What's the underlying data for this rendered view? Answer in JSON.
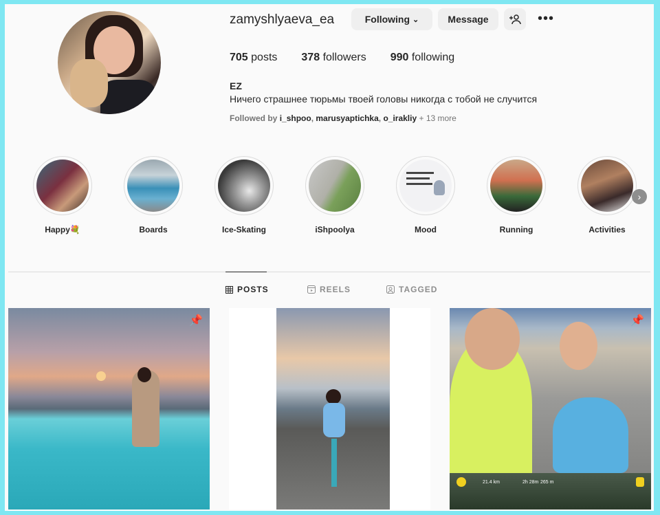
{
  "profile": {
    "username": "zamyshlyaeva_ea",
    "following_button": "Following",
    "message_button": "Message",
    "more_label": "•••",
    "posts_count": "705",
    "posts_label": "posts",
    "followers_count": "378",
    "followers_label": "followers",
    "following_count": "990",
    "following_label": "following",
    "name": "EZ",
    "bio": "Ничего страшнее тюрьмы твоей головы никогда с тобой не случится",
    "followed_by_prefix": "Followed by",
    "followed_by_accounts": [
      "i_shpoo",
      "marusyaptichka",
      "o_irakliy"
    ],
    "followed_by_more": "+ 13 more"
  },
  "highlights": [
    {
      "label": "Happy💐",
      "color": "#7a3040"
    },
    {
      "label": "Boards",
      "color": "#4a7fa0"
    },
    {
      "label": "Ice-Skating",
      "color": "#5a5a5a"
    },
    {
      "label": "iShpoolya",
      "color": "#8aa06a"
    },
    {
      "label": "Mood",
      "color": "#e8e8ec"
    },
    {
      "label": "Running",
      "color": "#b07050"
    },
    {
      "label": "Activities",
      "color": "#6a4a3a"
    }
  ],
  "tabs": [
    {
      "label": "POSTS",
      "icon": "grid-icon"
    },
    {
      "label": "REELS",
      "icon": "reels-icon"
    },
    {
      "label": "TAGGED",
      "icon": "tag-icon"
    }
  ],
  "posts": [
    {
      "subject": "sunset pool",
      "pinned": true
    },
    {
      "subject": "bike pier",
      "pinned": false
    },
    {
      "subject": "marathon selfie",
      "pinned": true
    }
  ],
  "post_map_labels": [
    "21.4 km",
    "2h 28m",
    "265 m"
  ]
}
